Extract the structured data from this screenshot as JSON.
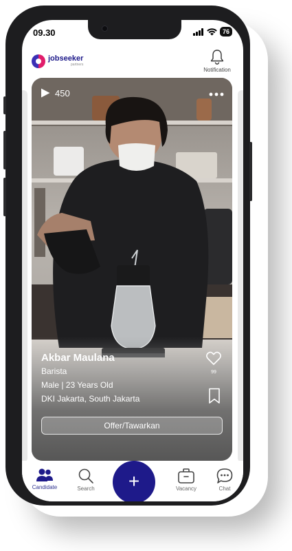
{
  "status_bar": {
    "time": "09.30",
    "battery": "76"
  },
  "header": {
    "logo_name": "jobseeker",
    "logo_sub": "partners",
    "notification_label": "Notification"
  },
  "candidate_card": {
    "views": "450",
    "name": "Akbar Maulana",
    "role": "Barista",
    "gender_age": "Male | 23 Years Old",
    "location": "DKI Jakarta, South Jakarta",
    "likes": "99",
    "offer_button": "Offer/Tawarkan",
    "more_icon": "more-horizontal-icon"
  },
  "tabbar": {
    "items": [
      {
        "label": "Candidate",
        "icon": "users-icon",
        "active": true
      },
      {
        "label": "Search",
        "icon": "search-icon",
        "active": false
      },
      {
        "label": "Vacancy",
        "icon": "briefcase-icon",
        "active": false
      },
      {
        "label": "Chat",
        "icon": "chat-bubble-icon",
        "active": false
      }
    ],
    "fab_label": "+"
  },
  "colors": {
    "brand": "#1e1a8a",
    "accent": "#e11d6b"
  }
}
